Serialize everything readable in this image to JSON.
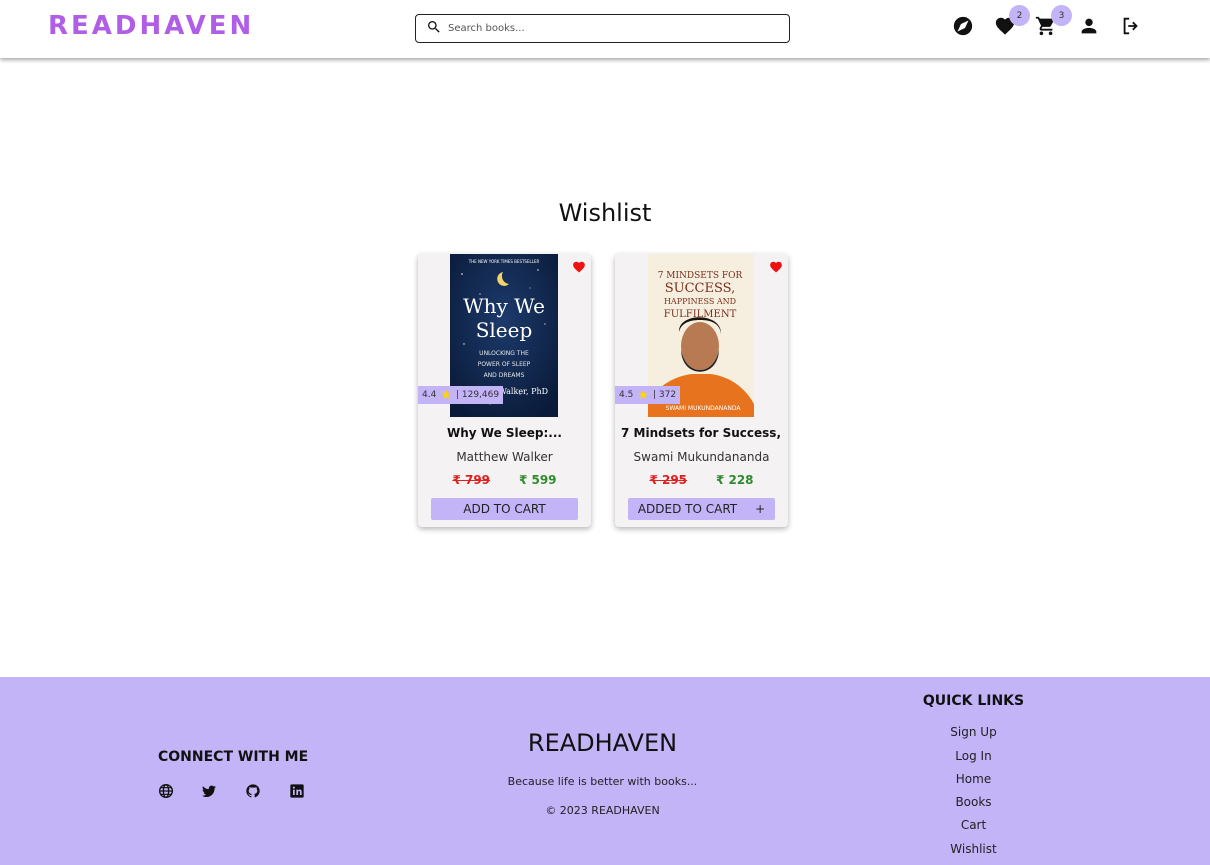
{
  "header": {
    "logo": "READHAVEN",
    "search_placeholder": "Search books...",
    "wishlist_count": "2",
    "cart_count": "3"
  },
  "main": {
    "title": "Wishlist",
    "books": [
      {
        "title": "Why We Sleep:...",
        "author": "Matthew Walker",
        "rating": "4.4",
        "reviews": "| 129,469",
        "original_price": "₹ 799",
        "price": "₹ 599",
        "button": "ADD TO CART",
        "cover": {
          "top_line": "THE NEW YORK TIMES BESTSELLER",
          "title_line1": "Why We",
          "title_line2": "Sleep",
          "sub1": "UNLOCKING THE",
          "sub2": "POWER OF SLEEP",
          "sub3": "AND DREAMS",
          "author": "Matthew Walker, PhD"
        }
      },
      {
        "title": "7 Mindsets for Success,...",
        "author": "Swami Mukundananda",
        "rating": "4.5",
        "reviews": "| 372",
        "original_price": "₹ 295",
        "price": "₹ 228",
        "button": "ADDED TO CART",
        "button_icon": "+",
        "cover": {
          "line1": "7 MINDSETS FOR",
          "line2": "SUCCESS,",
          "line3": "HAPPINESS AND",
          "line4": "FULFILMENT",
          "author": "SWAMI MUKUNDANANDA"
        }
      }
    ]
  },
  "footer": {
    "connect_title": "CONNECT WITH ME",
    "brand": "READHAVEN",
    "tagline": "Because life is better with books...",
    "copyright": "© 2023 READHAVEN",
    "quick_links_title": "QUICK LINKS",
    "quick_links": [
      "Sign Up",
      "Log In",
      "Home",
      "Books",
      "Cart",
      "Wishlist"
    ]
  },
  "colors": {
    "brand": "#b05ee6",
    "accent": "#c3b3f7",
    "heart": "#ee1111",
    "old_price": "#e02020",
    "new_price": "#2e8b2e"
  },
  "icons": [
    "search-icon",
    "compass-icon",
    "heart-icon",
    "cart-icon",
    "user-icon",
    "logout-icon",
    "star-icon",
    "globe-icon",
    "twitter-icon",
    "github-icon",
    "linkedin-icon"
  ]
}
